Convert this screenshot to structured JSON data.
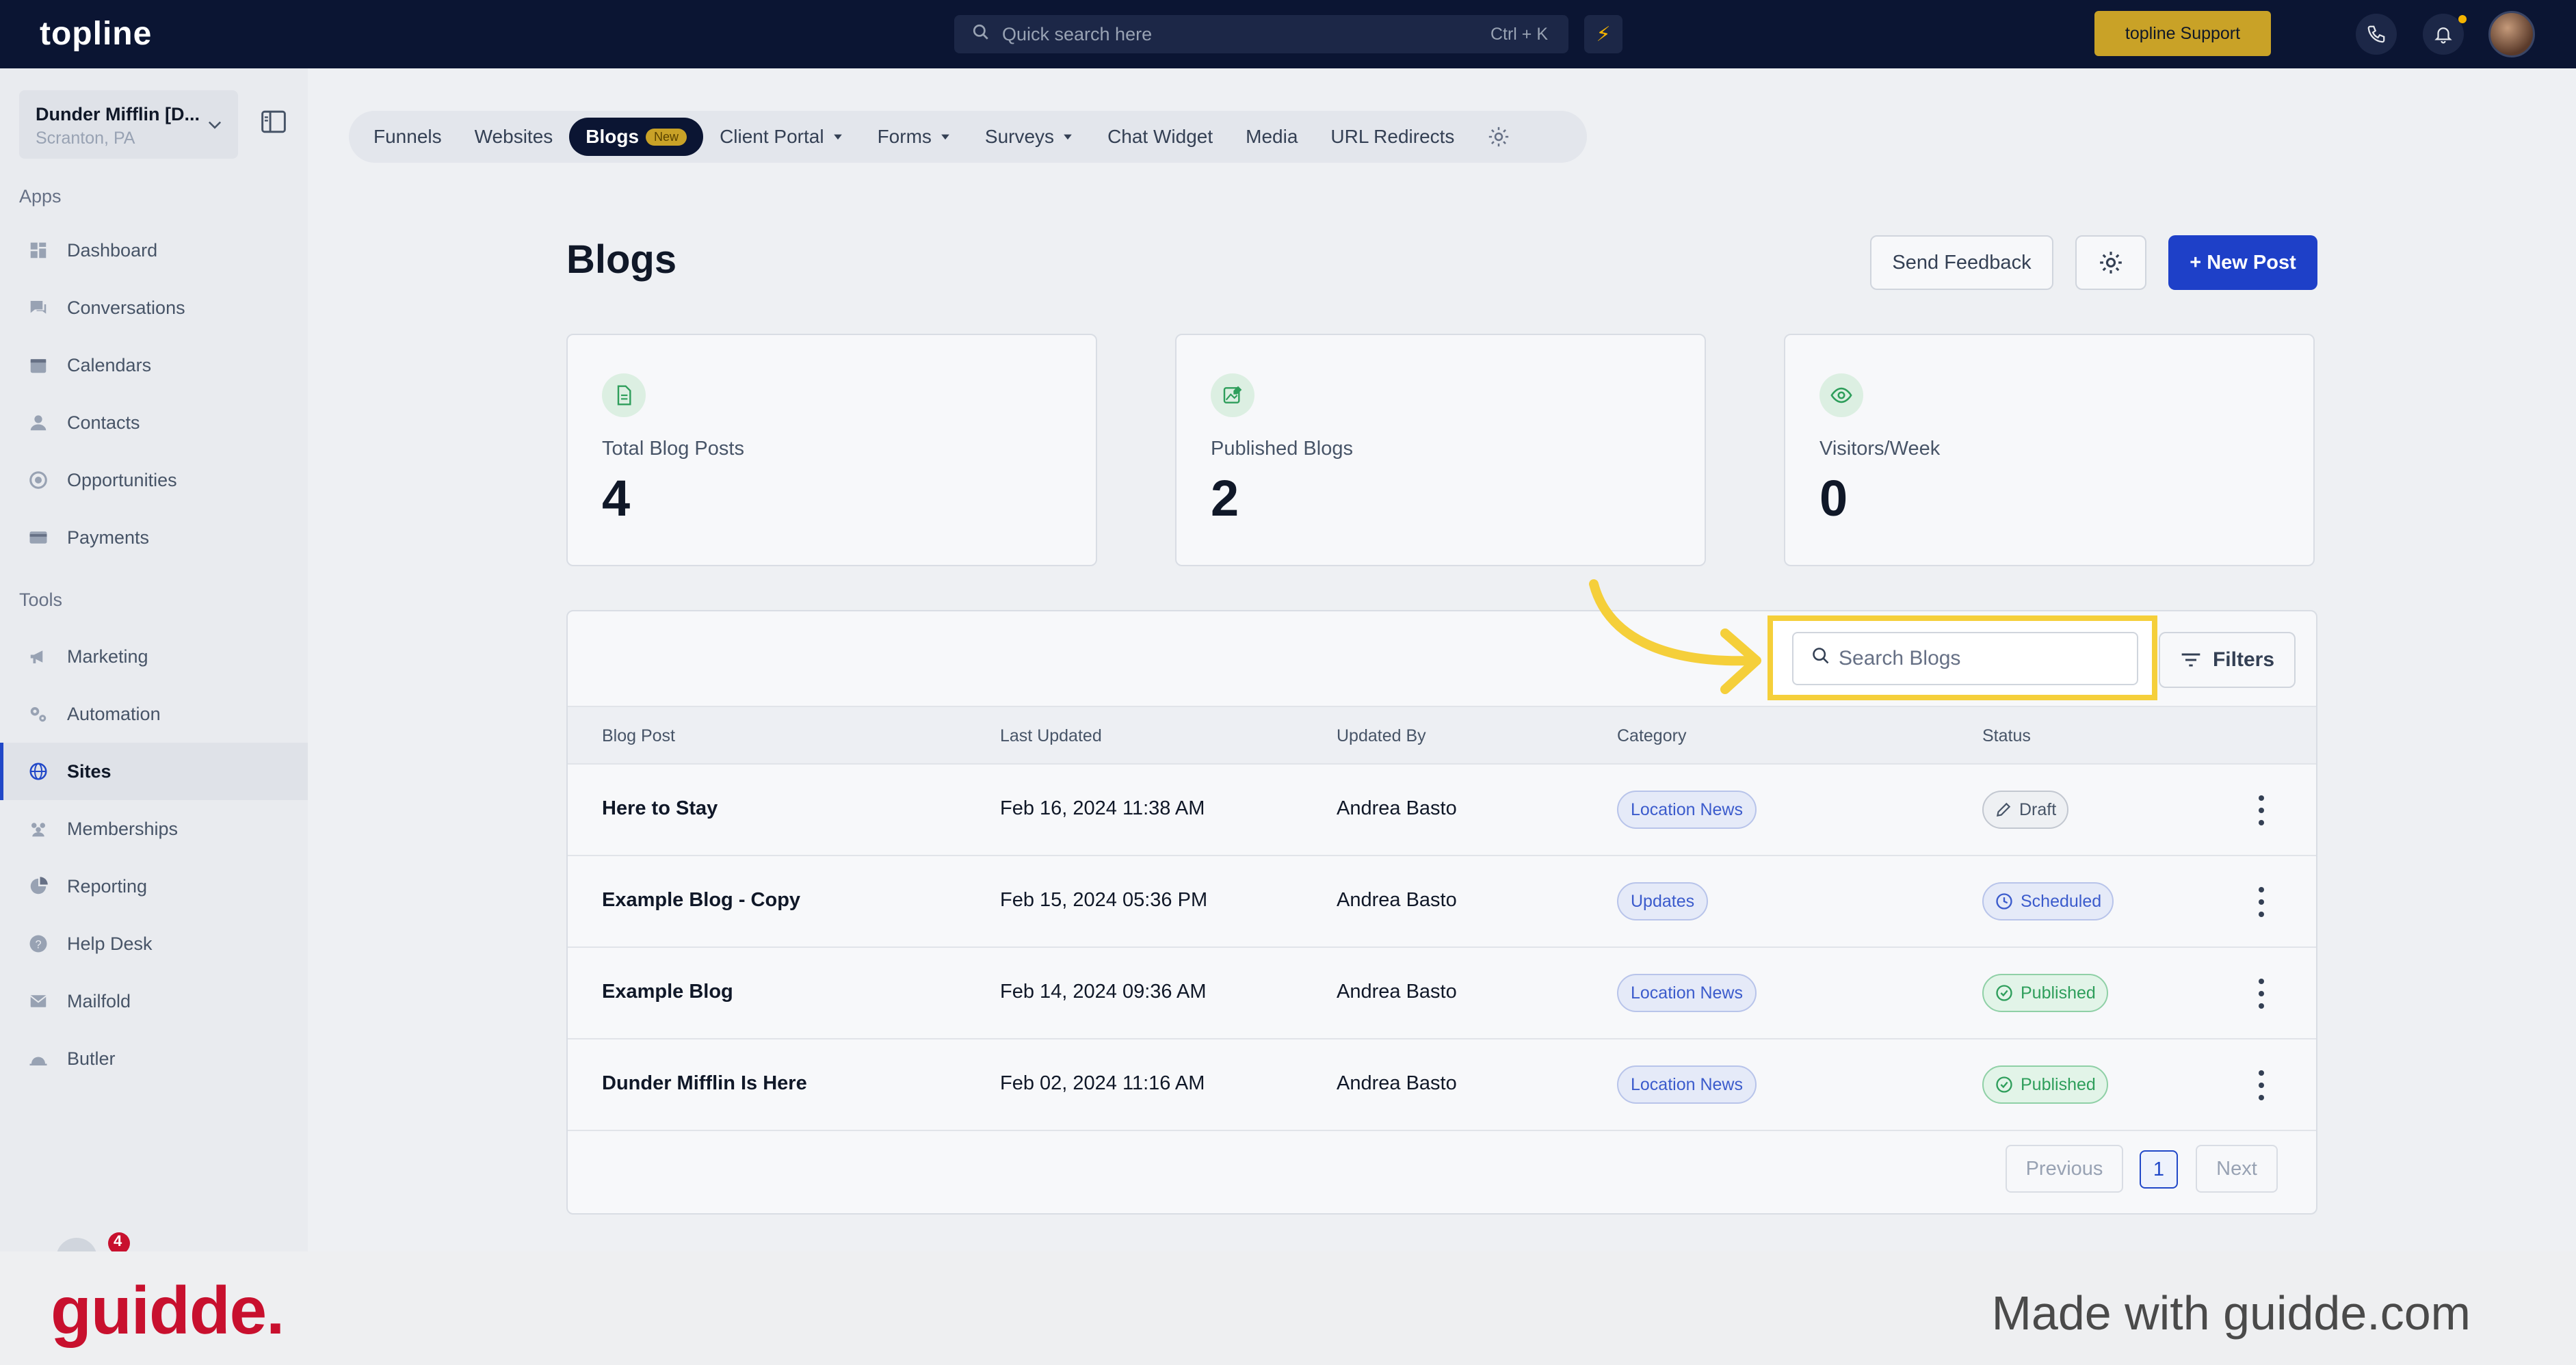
{
  "topbar": {
    "logo": "topline",
    "search_placeholder": "Quick search here",
    "search_shortcut": "Ctrl + K",
    "support_label": "topline Support"
  },
  "sidebar": {
    "location_name": "Dunder Mifflin [D...",
    "location_sub": "Scranton, PA",
    "section_apps": "Apps",
    "section_tools": "Tools",
    "apps": [
      {
        "label": "Dashboard",
        "icon": "dashboard-icon"
      },
      {
        "label": "Conversations",
        "icon": "chat-icon"
      },
      {
        "label": "Calendars",
        "icon": "calendar-icon"
      },
      {
        "label": "Contacts",
        "icon": "contact-icon"
      },
      {
        "label": "Opportunities",
        "icon": "target-icon"
      },
      {
        "label": "Payments",
        "icon": "card-icon"
      }
    ],
    "tools": [
      {
        "label": "Marketing",
        "icon": "megaphone-icon"
      },
      {
        "label": "Automation",
        "icon": "gears-icon"
      },
      {
        "label": "Sites",
        "icon": "globe-icon",
        "active": true
      },
      {
        "label": "Memberships",
        "icon": "members-icon"
      },
      {
        "label": "Reporting",
        "icon": "pie-icon"
      },
      {
        "label": "Help Desk",
        "icon": "help-icon"
      },
      {
        "label": "Mailfold",
        "icon": "mail-icon"
      },
      {
        "label": "Butler",
        "icon": "bell-icon"
      }
    ],
    "notification_count": "4"
  },
  "tabs": [
    {
      "label": "Funnels"
    },
    {
      "label": "Websites"
    },
    {
      "label": "Blogs",
      "badge": "New",
      "active": true
    },
    {
      "label": "Client Portal",
      "dropdown": true
    },
    {
      "label": "Forms",
      "dropdown": true
    },
    {
      "label": "Surveys",
      "dropdown": true
    },
    {
      "label": "Chat Widget"
    },
    {
      "label": "Media"
    },
    {
      "label": "URL Redirects"
    }
  ],
  "page": {
    "title": "Blogs",
    "send_feedback": "Send Feedback",
    "new_post": "+ New Post"
  },
  "stats": [
    {
      "label": "Total Blog Posts",
      "value": "4",
      "icon": "document-icon"
    },
    {
      "label": "Published Blogs",
      "value": "2",
      "icon": "image-edit-icon"
    },
    {
      "label": "Visitors/Week",
      "value": "0",
      "icon": "eye-icon"
    }
  ],
  "table": {
    "search_placeholder": "Search Blogs",
    "filters_label": "Filters",
    "headers": [
      "Blog Post",
      "Last Updated",
      "Updated By",
      "Category",
      "Status"
    ],
    "rows": [
      {
        "title": "Here to Stay",
        "updated": "Feb 16, 2024 11:38 AM",
        "by": "Andrea Basto",
        "category": "Location News",
        "status": "Draft"
      },
      {
        "title": "Example Blog - Copy",
        "updated": "Feb 15, 2024 05:36 PM",
        "by": "Andrea Basto",
        "category": "Updates",
        "status": "Scheduled"
      },
      {
        "title": "Example Blog",
        "updated": "Feb 14, 2024 09:36 AM",
        "by": "Andrea Basto",
        "category": "Location News",
        "status": "Published"
      },
      {
        "title": "Dunder Mifflin Is Here",
        "updated": "Feb 02, 2024 11:16 AM",
        "by": "Andrea Basto",
        "category": "Location News",
        "status": "Published"
      }
    ],
    "pager": {
      "previous": "Previous",
      "page": "1",
      "next": "Next"
    }
  },
  "footer": {
    "logo": "guidde.",
    "made_with": "Made with guidde.com"
  },
  "colors": {
    "topbar": "#0b1533",
    "primary": "#1e40c8",
    "highlight": "#f5cf3a",
    "brand_red": "#c8102e"
  }
}
